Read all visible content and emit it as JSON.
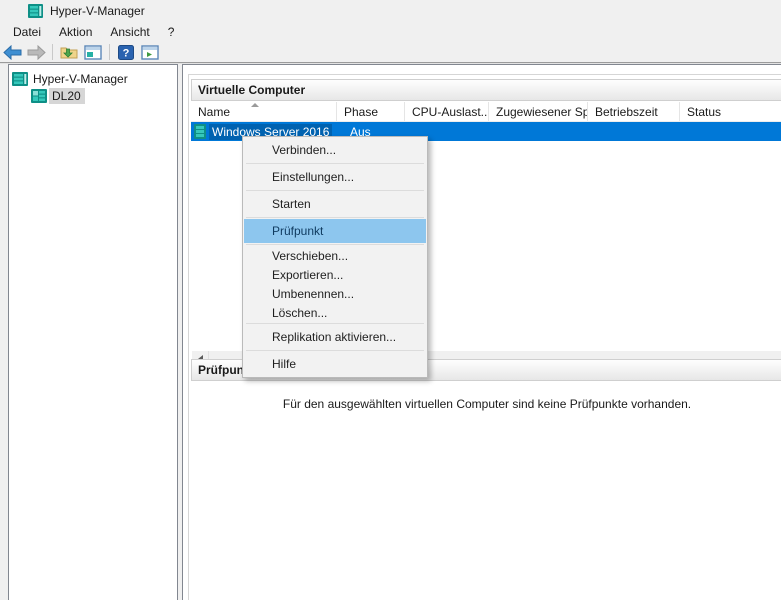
{
  "window": {
    "title": "Hyper-V-Manager"
  },
  "menu_bar": {
    "items": [
      {
        "label": "Datei"
      },
      {
        "label": "Aktion"
      },
      {
        "label": "Ansicht"
      },
      {
        "label": "?"
      }
    ]
  },
  "toolbar": {
    "icons": [
      {
        "name": "back-icon"
      },
      {
        "name": "forward-icon"
      },
      {
        "name": "export-folder-icon"
      },
      {
        "name": "console-window-icon"
      },
      {
        "name": "help-icon"
      },
      {
        "name": "show-window-icon"
      }
    ]
  },
  "tree": {
    "root": {
      "label": "Hyper-V-Manager"
    },
    "child": {
      "label": "DL20",
      "selected": true
    }
  },
  "vm_panel": {
    "title": "Virtuelle Computer",
    "columns": [
      "Name",
      "Phase",
      "CPU-Auslast...",
      "Zugewiesener Spei...",
      "Betriebszeit",
      "Status"
    ],
    "sort": {
      "column": "Name",
      "direction": "asc"
    },
    "rows": [
      {
        "name": "Windows Server 2016",
        "phase": "Aus",
        "selected": true
      }
    ]
  },
  "checkpoints_panel": {
    "title": "Prüfpunkte",
    "empty_message": "Für den ausgewählten virtuellen Computer sind keine Prüfpunkte vorhanden."
  },
  "context_menu": {
    "items": [
      {
        "label": "Verbinden...",
        "separator_after": true
      },
      {
        "label": "Einstellungen...",
        "separator_after": true
      },
      {
        "label": "Starten",
        "separator_after": true
      },
      {
        "label": "Prüfpunkt",
        "highlighted": true,
        "separator_after": true
      },
      {
        "label": "Verschieben..."
      },
      {
        "label": "Exportieren..."
      },
      {
        "label": "Umbenennen..."
      },
      {
        "label": "Löschen...",
        "separator_after": true
      },
      {
        "label": "Replikation aktivieren...",
        "separator_after": true
      },
      {
        "label": "Hilfe"
      }
    ]
  },
  "colors": {
    "selection_blue": "#0078d7",
    "menu_highlight_blue": "#8dc6ee",
    "tree_selection_gray": "#d6d6d6",
    "server_icon_teal": "#1fb3a7"
  }
}
